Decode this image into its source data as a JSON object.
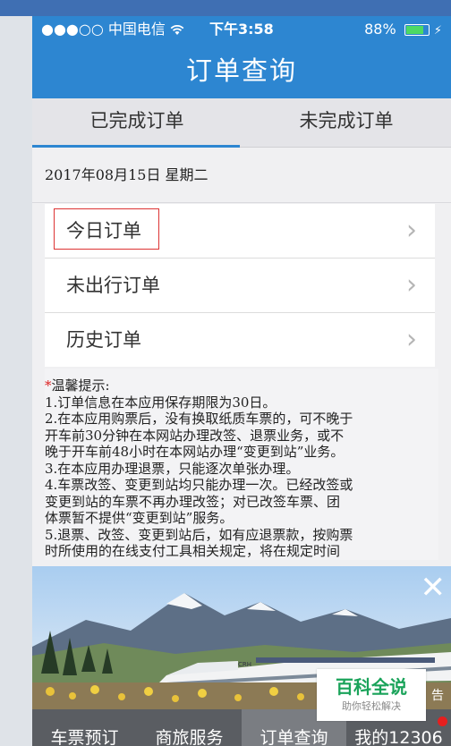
{
  "status_bar": {
    "carrier": "●●●○○ 中国电信 ",
    "wifi_icon": "wifi-icon",
    "time": "下午3:58",
    "battery": "88%",
    "battery_level": 0.88
  },
  "header": {
    "title": "订单查询"
  },
  "tabs": [
    {
      "label": "已完成订单",
      "active": true
    },
    {
      "label": "未完成订单",
      "active": false
    }
  ],
  "date_line": "2017年08月15日 星期二",
  "menu": [
    {
      "label": "今日订单",
      "highlighted": true
    },
    {
      "label": "未出行订单",
      "highlighted": false
    },
    {
      "label": "历史订单",
      "highlighted": false
    }
  ],
  "notice": {
    "asterisk": "*",
    "heading": "温馨提示:",
    "lines": [
      "1.订单信息在本应用保存期限为30日。",
      "2.在本应用购票后，没有换取纸质车票的，可不晚于",
      "开车前30分钟在本网站办理改签、退票业务，或不",
      "晚于开车前48小时在本网站办理“变更到站”业务。",
      "3.在本应用办理退票，只能逐次单张办理。",
      "4.车票改签、变更到站均只能办理一次。已经改签或",
      "变更到站的车票不再办理改签；对已改签车票、团",
      "体票暂不提供“变更到站”服务。",
      "5.退票、改签、变更到站后，如有应退票款，按购票",
      "时所使用的在线支付工具相关规定，将在规定时间"
    ]
  },
  "banner": {
    "close": "✕",
    "ad_tag": "告",
    "train_logo": "CRH"
  },
  "watermark": {
    "title": "百科全说",
    "subtitle": "助你轻松解决"
  },
  "tabbar": [
    {
      "label": "车票预订",
      "active": false
    },
    {
      "label": "商旅服务",
      "active": false
    },
    {
      "label": "订单查询",
      "active": true
    },
    {
      "label": "我的12306",
      "active": false
    }
  ],
  "colors": {
    "header": "#2d86d1",
    "tabbar": "#5a5d62",
    "highlight_border": "#dd3333",
    "badge": "#e51f1f"
  }
}
